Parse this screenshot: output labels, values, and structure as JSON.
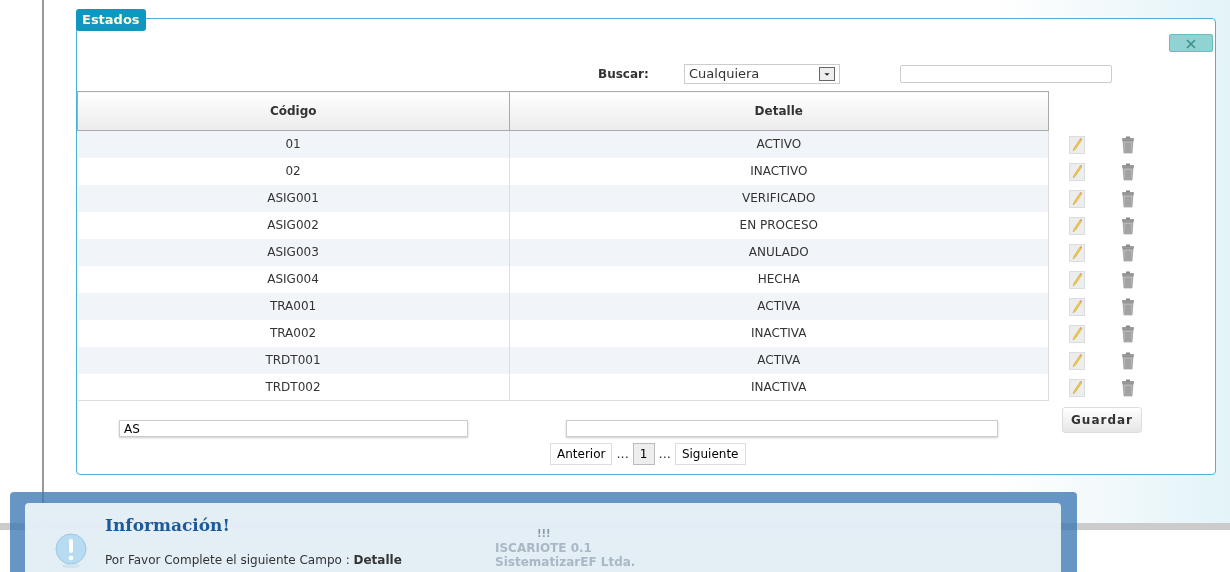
{
  "panel": {
    "title": "Estados"
  },
  "search": {
    "label": "Buscar:",
    "filter": "Cualquiera"
  },
  "table": {
    "columns": [
      "Código",
      "Detalle"
    ],
    "rows": [
      {
        "codigo": "01",
        "detalle": "ACTIVO"
      },
      {
        "codigo": "02",
        "detalle": "INACTIVO"
      },
      {
        "codigo": "ASIG001",
        "detalle": "VERIFICADO"
      },
      {
        "codigo": "ASIG002",
        "detalle": "EN PROCESO"
      },
      {
        "codigo": "ASIG003",
        "detalle": "ANULADO"
      },
      {
        "codigo": "ASIG004",
        "detalle": "HECHA"
      },
      {
        "codigo": "TRA001",
        "detalle": "ACTIVA"
      },
      {
        "codigo": "TRA002",
        "detalle": "INACTIVA"
      },
      {
        "codigo": "TRDT001",
        "detalle": "ACTIVA"
      },
      {
        "codigo": "TRDT002",
        "detalle": "INACTIVA"
      }
    ]
  },
  "form": {
    "codigo": "AS",
    "save": "Guardar"
  },
  "pagination": {
    "prev": "Anterior",
    "ellipsis_before": "...",
    "pages": [
      {
        "label": "1",
        "selected": true
      }
    ],
    "ellipsis_after": "...",
    "next": "Siguiente"
  },
  "footer": {
    "mark": "!!!",
    "line1": "ISCARIOTE 0.1",
    "line2": "SistematizarEF Ltda."
  },
  "notification": {
    "title": "Información!",
    "message": "Por Favor Complete el siguiente Campo  : **Detalle**"
  }
}
